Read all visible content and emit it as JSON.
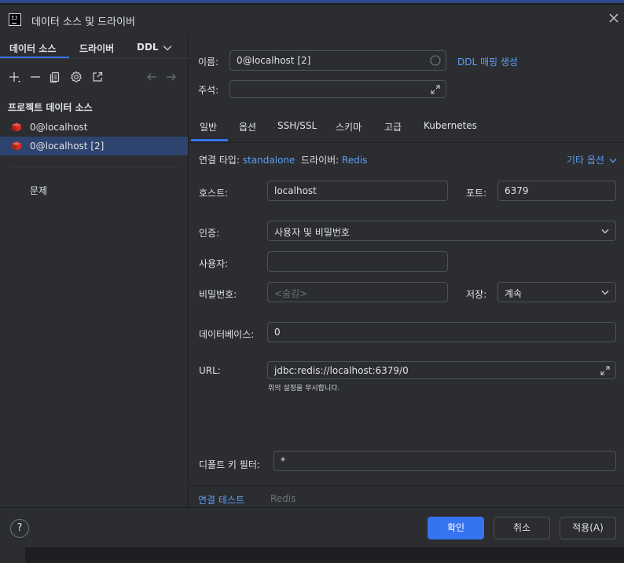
{
  "window": {
    "title": "데이터 소스 및 드라이버"
  },
  "left": {
    "tabs": [
      "데이터 소스",
      "드라이버",
      "DDL"
    ],
    "section_title": "프로젝트 데이터 소스",
    "items": [
      {
        "label": "0@localhost"
      },
      {
        "label": "0@localhost [2]"
      }
    ],
    "problems": "문제"
  },
  "form": {
    "name_label": "이름:",
    "name_value": "0@localhost [2]",
    "ddl_link": "DDL 매핑 생성",
    "comment_label": "주석:",
    "comment_value": ""
  },
  "tabs": [
    "일반",
    "옵션",
    "SSH/SSL",
    "스키마",
    "고급",
    "Kubernetes"
  ],
  "general": {
    "conn_type_label": "연결 타입:",
    "conn_type_value": "standalone",
    "driver_label": "드라이버:",
    "driver_value": "Redis",
    "other_options": "기타 옵션",
    "host_label": "호스트:",
    "host_value": "localhost",
    "port_label": "포트:",
    "port_value": "6379",
    "auth_label": "인증:",
    "auth_value": "사용자 및 비밀번호",
    "user_label": "사용자:",
    "user_value": "",
    "password_label": "비밀번호:",
    "password_placeholder": "<숨김>",
    "save_label": "저장:",
    "save_value": "계속",
    "database_label": "데이터베이스:",
    "database_value": "0",
    "url_label": "URL:",
    "url_value": "jdbc:redis://localhost:6379/0",
    "url_hint": "위의 설정을 무시합니다.",
    "filter_label": "디폴트 키 필터:",
    "filter_value": "*"
  },
  "bottom_links": {
    "test": "연결 테스트",
    "driver": "Redis"
  },
  "footer": {
    "help": "?",
    "ok": "확인",
    "cancel": "취소",
    "apply": "적용(A)"
  },
  "colors": {
    "accent": "#3574f0",
    "link": "#5e9ef5",
    "selection": "#2e436e",
    "redis": "#d82c20"
  }
}
